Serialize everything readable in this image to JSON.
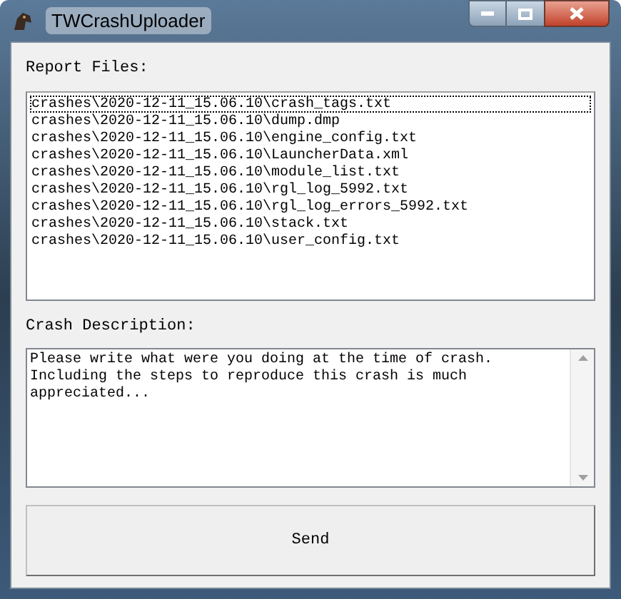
{
  "window": {
    "title": "TWCrashUploader"
  },
  "report_files": {
    "label": "Report Files:",
    "items": [
      {
        "text": "crashes\\2020-12-11_15.06.10\\crash_tags.txt",
        "focused": true
      },
      {
        "text": "crashes\\2020-12-11_15.06.10\\dump.dmp",
        "focused": false
      },
      {
        "text": "crashes\\2020-12-11_15.06.10\\engine_config.txt",
        "focused": false
      },
      {
        "text": "crashes\\2020-12-11_15.06.10\\LauncherData.xml",
        "focused": false
      },
      {
        "text": "crashes\\2020-12-11_15.06.10\\module_list.txt",
        "focused": false
      },
      {
        "text": "crashes\\2020-12-11_15.06.10\\rgl_log_5992.txt",
        "focused": false
      },
      {
        "text": "crashes\\2020-12-11_15.06.10\\rgl_log_errors_5992.txt",
        "focused": false
      },
      {
        "text": "crashes\\2020-12-11_15.06.10\\stack.txt",
        "focused": false
      },
      {
        "text": "crashes\\2020-12-11_15.06.10\\user_config.txt",
        "focused": false
      }
    ]
  },
  "crash_description": {
    "label": "Crash Description:",
    "value": "Please write what were you doing at the time of crash.\nIncluding the steps to reproduce this crash is much\nappreciated..."
  },
  "buttons": [
    "Send"
  ]
}
